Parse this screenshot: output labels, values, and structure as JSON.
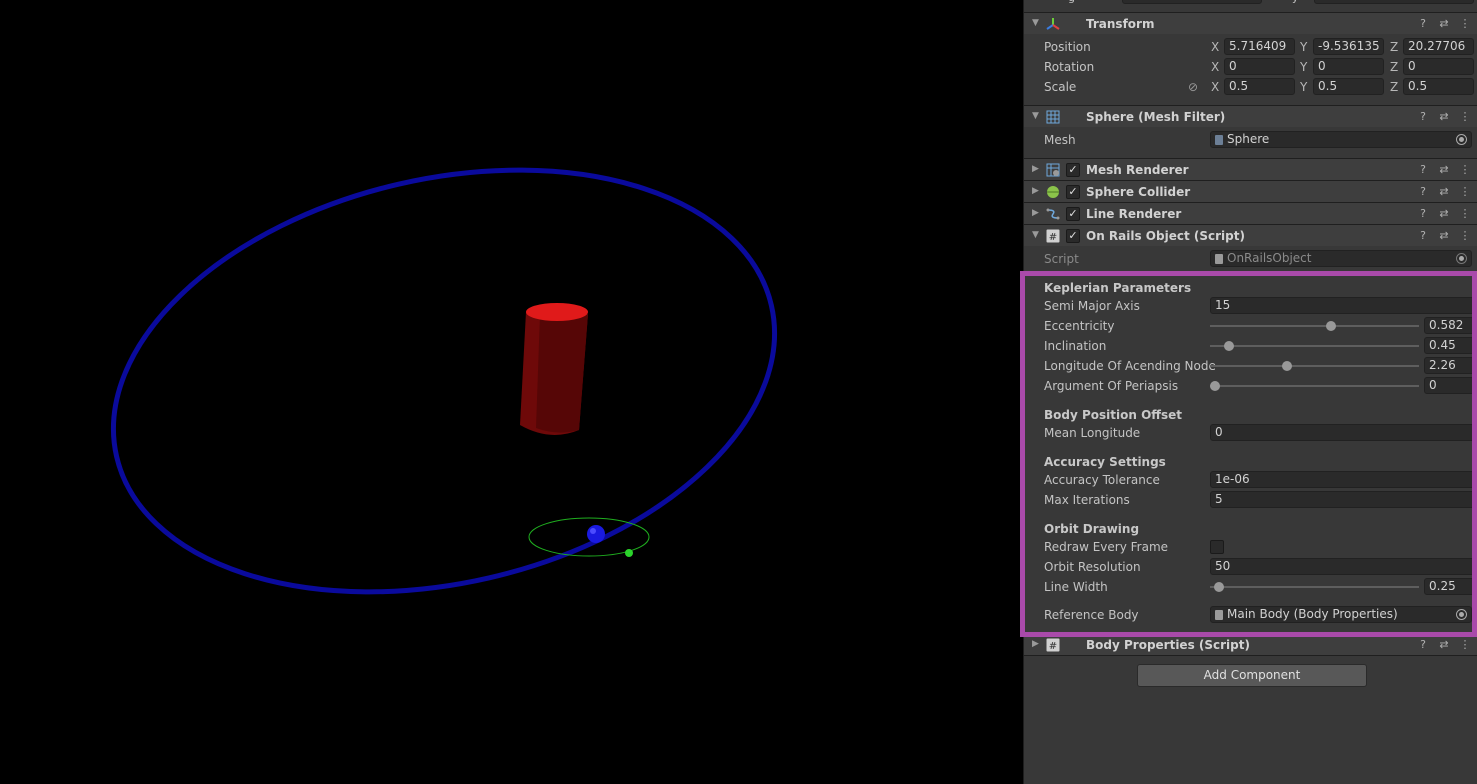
{
  "transform": {
    "title": "Transform",
    "position": {
      "label": "Position",
      "x": "5.716409",
      "y": "-9.536135",
      "z": "20.27706"
    },
    "rotation": {
      "label": "Rotation",
      "x": "0",
      "y": "0",
      "z": "0"
    },
    "scale": {
      "label": "Scale",
      "x": "0.5",
      "y": "0.5",
      "z": "0.5"
    },
    "axis_x": "X",
    "axis_y": "Y",
    "axis_z": "Z"
  },
  "mesh_filter": {
    "title": "Sphere (Mesh Filter)",
    "mesh_label": "Mesh",
    "mesh_value": "Sphere"
  },
  "components": {
    "mesh_renderer": "Mesh Renderer",
    "sphere_collider": "Sphere Collider",
    "line_renderer": "Line Renderer",
    "on_rails": "On Rails Object (Script)",
    "body_properties": "Body Properties (Script)"
  },
  "on_rails": {
    "script_label": "Script",
    "script_value": "OnRailsObject",
    "keplerian_header": "Keplerian Parameters",
    "semi_major_axis": {
      "label": "Semi Major Axis",
      "value": "15"
    },
    "eccentricity": {
      "label": "Eccentricity",
      "value": "0.582",
      "fraction": 0.582
    },
    "inclination": {
      "label": "Inclination",
      "value": "0.45",
      "fraction": 0.07
    },
    "longitude_node": {
      "label": "Longitude Of Acending Node",
      "value": "2.26",
      "fraction": 0.36
    },
    "argument_periapsis": {
      "label": "Argument Of Periapsis",
      "value": "0",
      "fraction": 0.0
    },
    "position_header": "Body Position Offset",
    "mean_longitude": {
      "label": "Mean Longitude",
      "value": "0"
    },
    "accuracy_header": "Accuracy Settings",
    "accuracy_tolerance": {
      "label": "Accuracy Tolerance",
      "value": "1e-06"
    },
    "max_iterations": {
      "label": "Max Iterations",
      "value": "5"
    },
    "drawing_header": "Orbit Drawing",
    "redraw": {
      "label": "Redraw Every Frame",
      "checked": false
    },
    "orbit_resolution": {
      "label": "Orbit Resolution",
      "value": "50"
    },
    "line_width": {
      "label": "Line Width",
      "value": "0.25",
      "fraction": 0.02
    },
    "reference_body": {
      "label": "Reference Body",
      "value": "Main Body (Body Properties)"
    }
  },
  "add_component_label": "Add Component",
  "colors": {
    "orbit": "#0a0a9c",
    "cylinder": "#8e0c0c",
    "highlight": "#a94aaa",
    "gizmo": "#1fae1f"
  },
  "icons": {
    "transform": "transform-axes-icon",
    "mesh_filter": "grid-icon",
    "mesh_renderer": "grid-renderer-icon",
    "sphere_collider": "green-sphere-icon",
    "line_renderer": "line-icon",
    "script": "hash-icon"
  }
}
